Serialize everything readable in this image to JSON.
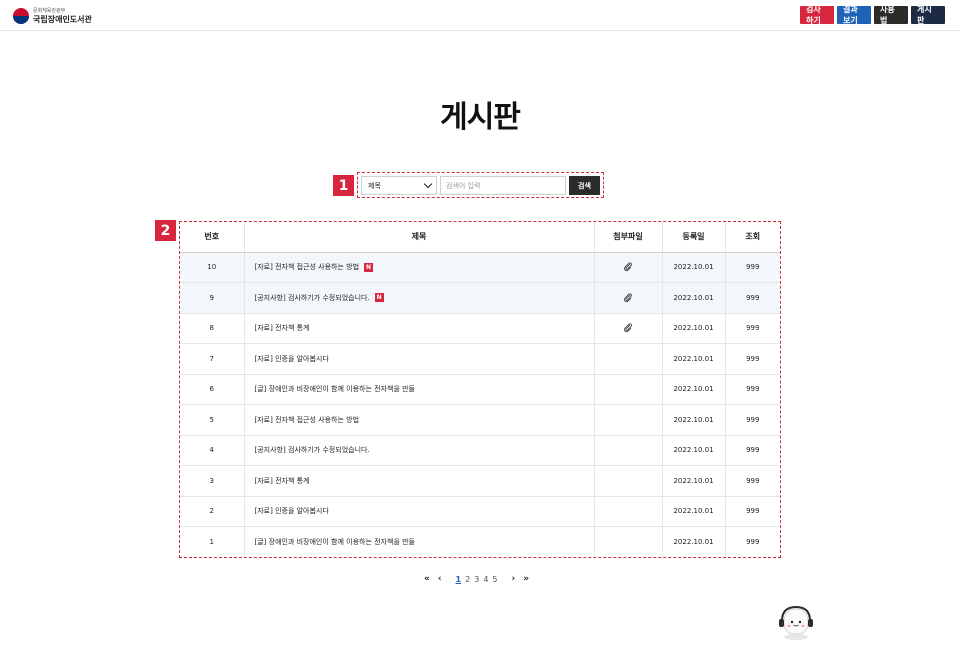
{
  "header": {
    "logo_sub": "문화체육관광부",
    "logo_main": "국립장애인도서관",
    "buttons": [
      "검사하기",
      "결과보기",
      "사용법",
      "게시판"
    ]
  },
  "page_title": "게시판",
  "markers": [
    "1",
    "2"
  ],
  "search": {
    "select_value": "제목",
    "placeholder": "검색어 입력",
    "button_label": "검색"
  },
  "table": {
    "columns": [
      "번호",
      "제목",
      "첨부파일",
      "등록일",
      "조회"
    ],
    "rows": [
      {
        "no": "10",
        "title": "[자료] 전자책 접근성 사용하는 방법",
        "new": "N",
        "attach": true,
        "date": "2022.10.01",
        "views": "999"
      },
      {
        "no": "9",
        "title": "[공지사항] 검사하기가 수정되었습니다.",
        "new": "N",
        "attach": true,
        "date": "2022.10.01",
        "views": "999"
      },
      {
        "no": "8",
        "title": "[자료] 전자책 통계",
        "new": "",
        "attach": true,
        "date": "2022.10.01",
        "views": "999"
      },
      {
        "no": "7",
        "title": "[자료] 인증을 알아봅시다",
        "new": "",
        "attach": false,
        "date": "2022.10.01",
        "views": "999"
      },
      {
        "no": "6",
        "title": "[글] 장애인과 비장애인이 함께 이용하는 전자책을 만들",
        "new": "",
        "attach": false,
        "date": "2022.10.01",
        "views": "999"
      },
      {
        "no": "5",
        "title": "[자료] 전자책 접근성 사용하는 방법",
        "new": "",
        "attach": false,
        "date": "2022.10.01",
        "views": "999"
      },
      {
        "no": "4",
        "title": "[공지사항] 검사하기가 수정되었습니다.",
        "new": "",
        "attach": false,
        "date": "2022.10.01",
        "views": "999"
      },
      {
        "no": "3",
        "title": "[자료] 전자책 통계",
        "new": "",
        "attach": false,
        "date": "2022.10.01",
        "views": "999"
      },
      {
        "no": "2",
        "title": "[자료] 인증을 알아봅시다",
        "new": "",
        "attach": false,
        "date": "2022.10.01",
        "views": "999"
      },
      {
        "no": "1",
        "title": "[글] 장애인과 비장애인이 함께 이용하는 전자책을 만들",
        "new": "",
        "attach": false,
        "date": "2022.10.01",
        "views": "999"
      }
    ]
  },
  "pagination": {
    "first": "«",
    "prev": "‹",
    "pages": [
      "1",
      "2",
      "3",
      "4",
      "5"
    ],
    "active": "1",
    "next": "›",
    "last": "»"
  },
  "icons": {
    "attach": "paperclip-icon",
    "mascot": "chatbot-mascot-icon"
  },
  "colors": {
    "accent_red": "#d7263d",
    "accent_blue": "#1e63b8",
    "dark": "#2b2b2b",
    "navy": "#1c2a44"
  }
}
